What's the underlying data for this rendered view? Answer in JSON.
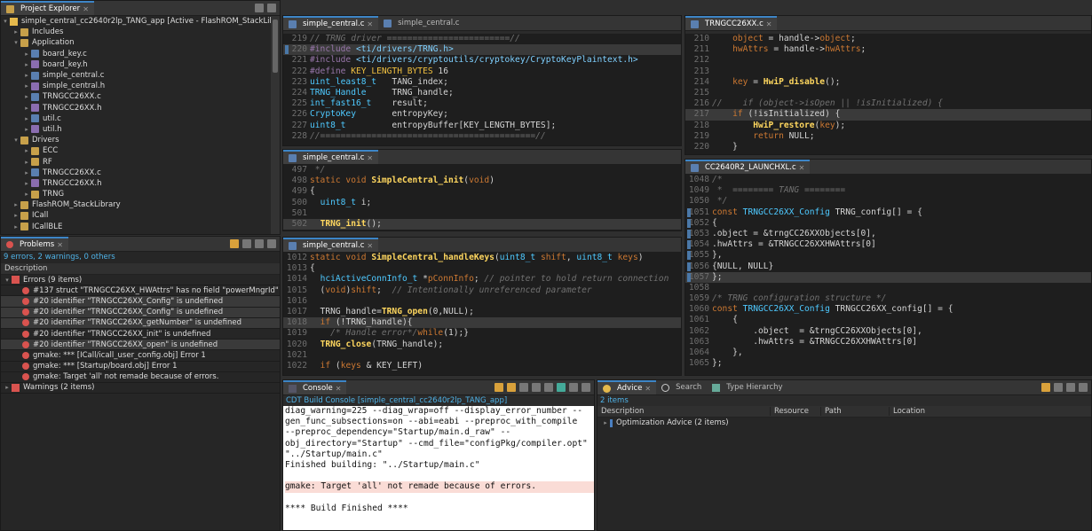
{
  "project_explorer": {
    "tab_label": "Project Explorer",
    "root": "simple_central_cc2640r2lp_TANG_app  [Active - FlashROM_StackLibrary]",
    "items": [
      {
        "label": "Includes",
        "depth": 1,
        "kind": "folder",
        "open": false
      },
      {
        "label": "Application",
        "depth": 1,
        "kind": "folder",
        "open": true
      },
      {
        "label": "board_key.c",
        "depth": 2,
        "kind": "c",
        "open": false
      },
      {
        "label": "board_key.h",
        "depth": 2,
        "kind": "h",
        "open": false
      },
      {
        "label": "simple_central.c",
        "depth": 2,
        "kind": "c",
        "open": false
      },
      {
        "label": "simple_central.h",
        "depth": 2,
        "kind": "h",
        "open": false
      },
      {
        "label": "TRNGCC26XX.c",
        "depth": 2,
        "kind": "c",
        "open": false
      },
      {
        "label": "TRNGCC26XX.h",
        "depth": 2,
        "kind": "h",
        "open": false
      },
      {
        "label": "util.c",
        "depth": 2,
        "kind": "c",
        "open": false
      },
      {
        "label": "util.h",
        "depth": 2,
        "kind": "h",
        "open": false
      },
      {
        "label": "Drivers",
        "depth": 1,
        "kind": "folder",
        "open": true
      },
      {
        "label": "ECC",
        "depth": 2,
        "kind": "folder",
        "open": false
      },
      {
        "label": "RF",
        "depth": 2,
        "kind": "folder",
        "open": false
      },
      {
        "label": "TRNGCC26XX.c",
        "depth": 2,
        "kind": "c",
        "open": false
      },
      {
        "label": "TRNGCC26XX.h",
        "depth": 2,
        "kind": "h",
        "open": false
      },
      {
        "label": "TRNG",
        "depth": 2,
        "kind": "folder",
        "open": false
      },
      {
        "label": "FlashROM_StackLibrary",
        "depth": 1,
        "kind": "folder",
        "open": false
      },
      {
        "label": "ICall",
        "depth": 1,
        "kind": "folder",
        "open": false
      },
      {
        "label": "ICallBLE",
        "depth": 1,
        "kind": "folder",
        "open": false
      }
    ]
  },
  "problems": {
    "tab_label": "Problems",
    "summary": "9 errors, 2 warnings, 0 others",
    "column": "Description",
    "errors_group": "Errors (9 items)",
    "errors": [
      "#137 struct \"TRNGCC26XX_HWAttrs\" has no field \"powerMngrId\"",
      "#20 identifier \"TRNGCC26XX_Config\" is undefined",
      "#20 identifier \"TRNGCC26XX_Config\" is undefined",
      "#20 identifier \"TRNGCC26XX_getNumber\" is undefined",
      "#20 identifier \"TRNGCC26XX_init\" is undefined",
      "#20 identifier \"TRNGCC26XX_open\" is undefined",
      "gmake: *** [ICall/icall_user_config.obj] Error 1",
      "gmake: *** [Startup/board.obj] Error 1",
      "gmake: Target 'all' not remade because of errors."
    ],
    "warnings_group": "Warnings (2 items)"
  },
  "editor1": {
    "tabs": [
      "simple_central.c",
      "simple_central.c"
    ],
    "lines": [
      {
        "n": "219",
        "html": "<span class='cm'>// TRNG driver ========================//</span>"
      },
      {
        "n": "220",
        "html": "<span class='pp'>#include</span> <span class='inc'>&lt;ti/drivers/TRNG.h&gt;</span>",
        "hl": true,
        "mark": true
      },
      {
        "n": "221",
        "html": "<span class='pp'>#include</span> <span class='inc'>&lt;ti/drivers/cryptoutils/cryptokey/CryptoKeyPlaintext.h&gt;</span>"
      },
      {
        "n": "222",
        "html": "<span class='pp'>#define</span> <span class='macro'>KEY_LENGTH_BYTES</span> 16"
      },
      {
        "n": "223",
        "html": "<span class='ty'>uint_least8_t</span>   TANG_index;"
      },
      {
        "n": "224",
        "html": "<span class='ty'>TRNG_Handle</span>     TRNG_handle;"
      },
      {
        "n": "225",
        "html": "<span class='ty'>int_fast16_t</span>    result;"
      },
      {
        "n": "226",
        "html": "<span class='ty'>CryptoKey</span>       entropyKey;"
      },
      {
        "n": "227",
        "html": "<span class='ty'>uint8_t</span>         entropyBuffer[KEY_LENGTH_BYTES];"
      },
      {
        "n": "228",
        "html": "<span class='cm'>//==========================================//</span>"
      }
    ]
  },
  "editor2": {
    "tabs": [
      "simple_central.c"
    ],
    "lines": [
      {
        "n": "497",
        "html": "<span class='cm'> */</span>"
      },
      {
        "n": "498",
        "html": "<span class='kw'>static void</span> <span class='fn'>SimpleCentral_init</span>(<span class='kw'>void</span>)"
      },
      {
        "n": "499",
        "html": "{"
      },
      {
        "n": "500",
        "html": "  <span class='ty'>uint8_t</span> i;"
      },
      {
        "n": "501",
        "html": ""
      },
      {
        "n": "502",
        "html": "  <span class='fn'>TRNG_init</span>();",
        "hl": true
      }
    ]
  },
  "editor3": {
    "tabs": [
      "simple_central.c"
    ],
    "lines": [
      {
        "n": "1012",
        "html": "<span class='kw'>static void</span> <span class='fn'>SimpleCentral_handleKeys</span>(<span class='ty'>uint8_t</span> <span class='kw'>shift</span>, <span class='ty'>uint8_t</span> <span class='kw'>keys</span>)"
      },
      {
        "n": "1013",
        "html": "{"
      },
      {
        "n": "1014",
        "html": "  <span class='ty'>hciActiveConnInfo_t</span> *<span class='kw'>pConnInfo</span>; <span class='cm'>// pointer to hold return connection</span>"
      },
      {
        "n": "1015",
        "html": "  (<span class='kw'>void</span>)<span class='kw'>shift</span>;  <span class='cm'>// Intentionally unreferenced parameter</span>"
      },
      {
        "n": "1016",
        "html": ""
      },
      {
        "n": "1017",
        "html": "  TRNG_handle=<span class='fn'>TRNG_open</span>(0,NULL);"
      },
      {
        "n": "1018",
        "html": "  <span class='kw'>if</span> (!TRNG_handle){",
        "hl": true
      },
      {
        "n": "1019",
        "html": "    <span class='cm'>/* Handle error*/</span><span class='kw'>while</span>(1);}"
      },
      {
        "n": "1020",
        "html": "  <span class='fn'>TRNG_close</span>(TRNG_handle);"
      },
      {
        "n": "1021",
        "html": ""
      },
      {
        "n": "1022",
        "html": "  <span class='kw'>if</span> (<span class='kw'>keys</span> &amp; KEY_LEFT)"
      }
    ]
  },
  "editor4": {
    "tabs": [
      "TRNGCC26XX.c"
    ],
    "lines": [
      {
        "n": "210",
        "html": "    <span class='kw'>object</span> = handle-&gt;<span class='kw'>object</span>;"
      },
      {
        "n": "211",
        "html": "    <span class='kw'>hwAttrs</span> = handle-&gt;<span class='kw'>hwAttrs</span>;"
      },
      {
        "n": "212",
        "html": ""
      },
      {
        "n": "213",
        "html": ""
      },
      {
        "n": "214",
        "html": "    <span class='kw'>key</span> = <span class='fn'>HwiP_disable</span>();"
      },
      {
        "n": "215",
        "html": ""
      },
      {
        "n": "216",
        "html": "<span class='cm'>//    if (object-&gt;isOpen || !isInitialized) {</span>"
      },
      {
        "n": "217",
        "html": "    <span class='kw'>if</span> (!isInitialized) {",
        "hl": true
      },
      {
        "n": "218",
        "html": "        <span class='fn'>HwiP_restore</span>(<span class='kw'>key</span>);"
      },
      {
        "n": "219",
        "html": "        <span class='kw'>return</span> NULL;"
      },
      {
        "n": "220",
        "html": "    }"
      }
    ]
  },
  "editor5": {
    "tabs": [
      "CC2640R2_LAUNCHXL.c"
    ],
    "lines": [
      {
        "n": "1048",
        "html": "<span class='cm'>/*</span>"
      },
      {
        "n": "1049",
        "html": "<span class='cm'> *  ======== TANG ========</span>"
      },
      {
        "n": "1050",
        "html": "<span class='cm'> */</span>"
      },
      {
        "n": "1051",
        "html": "<span class='kw'>const</span> <span class='ty'>TRNGCC26XX_Config</span> TRNG_config[] = {",
        "mark": true
      },
      {
        "n": "1052",
        "html": "{",
        "mark": true
      },
      {
        "n": "1053",
        "html": ".object = &amp;trngCC26XXObjects[0],",
        "mark": true
      },
      {
        "n": "1054",
        "html": ".hwAttrs = &amp;TRNGCC26XXHWAttrs[0]",
        "mark": true
      },
      {
        "n": "1055",
        "html": "},",
        "mark": true
      },
      {
        "n": "1056",
        "html": "{NULL, NULL}",
        "mark": true
      },
      {
        "n": "1057",
        "html": "};",
        "mark": true,
        "hl": true
      },
      {
        "n": "1058",
        "html": ""
      },
      {
        "n": "1059",
        "html": "<span class='cm'>/* TRNG configuration structure */</span>"
      },
      {
        "n": "1060",
        "html": "<span class='kw'>const</span> <span class='ty'>TRNGCC26XX_Config</span> TRNGCC26XX_config[] = {"
      },
      {
        "n": "1061",
        "html": "    {"
      },
      {
        "n": "1062",
        "html": "        .object  = &amp;trngCC26XXObjects[0],"
      },
      {
        "n": "1063",
        "html": "        .hwAttrs = &amp;TRNGCC26XXHWAttrs[0]"
      },
      {
        "n": "1064",
        "html": "    },"
      },
      {
        "n": "1065",
        "html": "};"
      }
    ]
  },
  "console": {
    "tab_label": "Console",
    "header": "CDT Build Console [simple_central_cc2640r2lp_TANG_app]",
    "lines": [
      "diag_warning=225 --diag_wrap=off --display_error_number --",
      "gen_func_subsections=on --abi=eabi --preproc_with_compile",
      "--preproc_dependency=\"Startup/main.d_raw\" --",
      "obj_directory=\"Startup\" --cmd_file=\"configPkg/compiler.opt\"",
      "\"../Startup/main.c\"",
      "Finished building: \"../Startup/main.c\"",
      "",
      "gmake: Target 'all' not remade because of errors.",
      "",
      "**** Build Finished ****"
    ]
  },
  "advice": {
    "tabs": [
      "Advice",
      "Search",
      "Type Hierarchy"
    ],
    "count": "2 items",
    "columns": [
      "Description",
      "Resource",
      "Path",
      "Location"
    ],
    "row": "Optimization Advice (2 items)"
  }
}
